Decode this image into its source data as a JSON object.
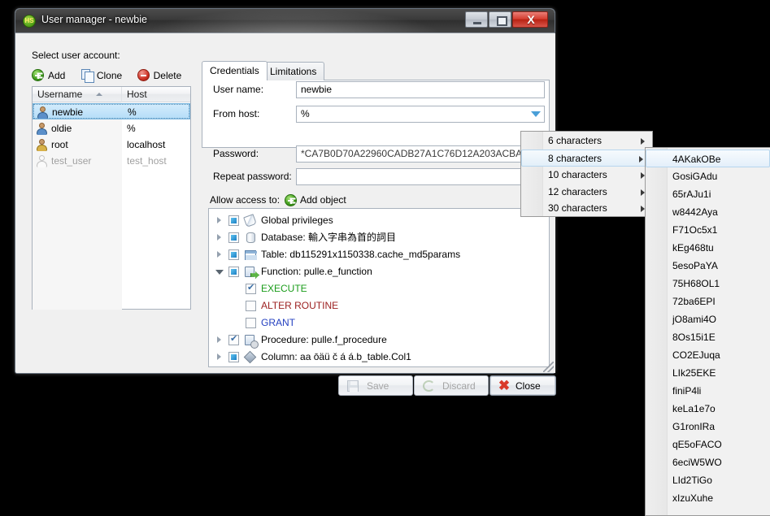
{
  "window": {
    "title": "User manager - newbie",
    "icon": "HS",
    "controls": {
      "minimize": "minimize-icon",
      "maximize": "restore-icon",
      "close": "X"
    }
  },
  "left_panel": {
    "select_label": "Select user account:",
    "toolbar": [
      {
        "label": "Add",
        "icon": "plus-circle-green-icon"
      },
      {
        "label": "Clone",
        "icon": "copy-pages-icon"
      },
      {
        "label": "Delete",
        "icon": "minus-circle-red-icon"
      }
    ],
    "columns": [
      "Username",
      "Host"
    ],
    "sort_column": "Username",
    "sort_direction": "ascending",
    "rows": [
      {
        "username": "newbie",
        "host": "%",
        "selected": true,
        "disabled": false,
        "icon": "user-icon"
      },
      {
        "username": "oldie",
        "host": "%",
        "selected": false,
        "disabled": false,
        "icon": "user-icon"
      },
      {
        "username": "root",
        "host": "localhost",
        "selected": false,
        "disabled": false,
        "icon": "user-admin-icon"
      },
      {
        "username": "test_user",
        "host": "test_host",
        "selected": false,
        "disabled": true,
        "icon": "user-ghost-icon"
      }
    ]
  },
  "right_panel": {
    "tabs": [
      {
        "label": "Credentials",
        "active": true
      },
      {
        "label": "Limitations",
        "active": false
      }
    ],
    "fields": [
      {
        "label": "User name:",
        "value": "newbie",
        "dropdown": false
      },
      {
        "label": "From host:",
        "value": "%",
        "dropdown": true
      },
      {
        "label": "Password:",
        "value": "*CA7B0D70A22960CADB27A1C76D12A203ACBA1A6E",
        "dropdown": true
      },
      {
        "label": "Repeat password:",
        "value": "",
        "dropdown": false
      }
    ],
    "allow_access_label": "Allow access to:",
    "add_object_label": "Add object",
    "tree": [
      {
        "label": "Global privileges",
        "check": "partial",
        "expanded": false,
        "icon": "globe-privileges-icon",
        "indent": 0,
        "color": "#000000"
      },
      {
        "label": "Database: 輸入字串為首的詞目",
        "check": "partial",
        "expanded": false,
        "icon": "database-icon",
        "indent": 0,
        "color": "#000000"
      },
      {
        "label": "Table: db115291x1150338.cache_md5params",
        "check": "partial",
        "expanded": false,
        "icon": "table-icon",
        "indent": 0,
        "color": "#000000"
      },
      {
        "label": "Function: pulle.e_function",
        "check": "partial",
        "expanded": true,
        "icon": "function-icon",
        "indent": 0,
        "color": "#000000"
      },
      {
        "label": "EXECUTE",
        "check": "checked",
        "expanded": null,
        "icon": null,
        "indent": 1,
        "color": "#1a9c1a"
      },
      {
        "label": "ALTER ROUTINE",
        "check": "unchecked",
        "expanded": null,
        "icon": null,
        "indent": 1,
        "color": "#9c2020"
      },
      {
        "label": "GRANT",
        "check": "unchecked",
        "expanded": null,
        "icon": null,
        "indent": 1,
        "color": "#2440c0"
      },
      {
        "label": "Procedure: pulle.f_procedure",
        "check": "checked",
        "expanded": false,
        "icon": "procedure-icon",
        "indent": 0,
        "color": "#000000"
      },
      {
        "label": "Column: aa ōäü č á á.b_table.Col1",
        "check": "partial",
        "expanded": false,
        "icon": "column-icon",
        "indent": 0,
        "color": "#000000"
      }
    ]
  },
  "buttons": [
    {
      "label": "Save",
      "icon": "floppy-disk-icon",
      "enabled": false
    },
    {
      "label": "Discard",
      "icon": "undo-arrow-icon",
      "enabled": false
    },
    {
      "label": "Close",
      "icon": "red-x-icon",
      "enabled": true
    }
  ],
  "menu_length": {
    "items": [
      {
        "label": "6 characters",
        "highlighted": false
      },
      {
        "label": "8 characters",
        "highlighted": true
      },
      {
        "label": "10 characters",
        "highlighted": false
      },
      {
        "label": "12 characters",
        "highlighted": false
      },
      {
        "label": "30 characters",
        "highlighted": false
      }
    ]
  },
  "menu_passwords": {
    "items": [
      {
        "label": "4AKakOBe",
        "highlighted": true
      },
      {
        "label": "GosiGAdu",
        "highlighted": false
      },
      {
        "label": "65rAJu1i",
        "highlighted": false
      },
      {
        "label": "w8442Aya",
        "highlighted": false
      },
      {
        "label": "F71Oc5x1",
        "highlighted": false
      },
      {
        "label": "kEg468tu",
        "highlighted": false
      },
      {
        "label": "5esoPaYA",
        "highlighted": false
      },
      {
        "label": "75H68OL1",
        "highlighted": false
      },
      {
        "label": "72ba6EPI",
        "highlighted": false
      },
      {
        "label": "jO8ami4O",
        "highlighted": false
      },
      {
        "label": "8Os15i1E",
        "highlighted": false
      },
      {
        "label": "CO2EJuqa",
        "highlighted": false
      },
      {
        "label": "LIk25EKE",
        "highlighted": false
      },
      {
        "label": "finiP4li",
        "highlighted": false
      },
      {
        "label": "keLa1e7o",
        "highlighted": false
      },
      {
        "label": "G1ronIRa",
        "highlighted": false
      },
      {
        "label": "qE5oFACO",
        "highlighted": false
      },
      {
        "label": "6eciW5WO",
        "highlighted": false
      },
      {
        "label": "LId2TiGo",
        "highlighted": false
      },
      {
        "label": "xIzuXuhe",
        "highlighted": false
      }
    ]
  },
  "colors": {
    "accent_blue": "#4a9fd8",
    "selection": "#b5ddf8",
    "execute_green": "#1a9c1a",
    "alter_red": "#9c2020",
    "grant_blue": "#2440c0",
    "close_red": "#d93a2a"
  }
}
